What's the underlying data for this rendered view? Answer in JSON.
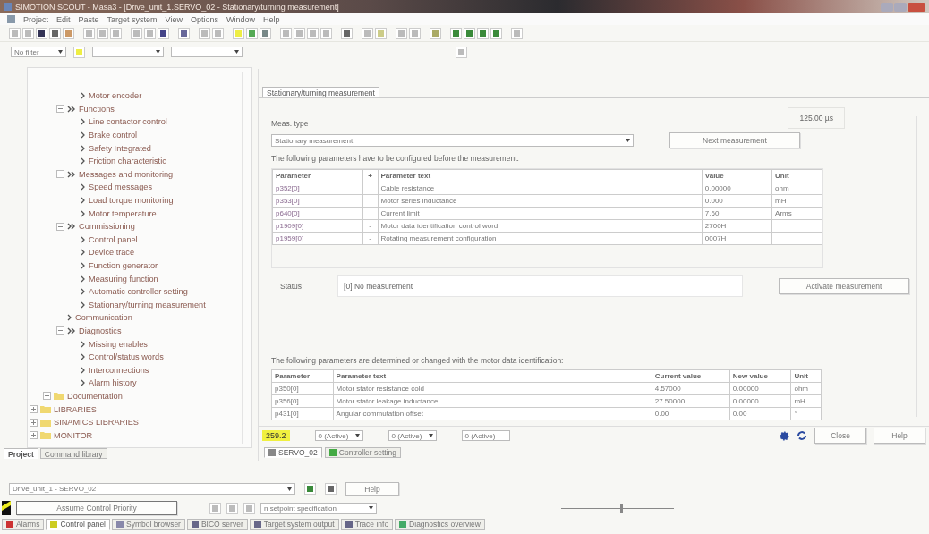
{
  "window": {
    "title": "SIMOTION SCOUT - Masa3 - [Drive_unit_1.SERVO_02 - Stationary/turning measurement]"
  },
  "menu": [
    "Project",
    "Edit",
    "Paste",
    "Target system",
    "View",
    "Options",
    "Window",
    "Help"
  ],
  "filter": {
    "value": "No filter"
  },
  "tree": [
    {
      "children": [
        {
          "children": [
            {
              "children": [
                {
                  "label": "Motor encoder",
                  "kind": "function"
                }
              ]
            },
            {
              "label": "Functions",
              "kind": "section",
              "expanded": true,
              "children": [
                {
                  "label": "Line contactor control",
                  "kind": "function"
                },
                {
                  "label": "Brake control",
                  "kind": "function"
                },
                {
                  "label": "Safety Integrated",
                  "kind": "function"
                },
                {
                  "label": "Friction characteristic",
                  "kind": "function"
                }
              ]
            },
            {
              "label": "Messages and monitoring",
              "kind": "section",
              "expanded": true,
              "children": [
                {
                  "label": "Speed messages",
                  "kind": "function"
                },
                {
                  "label": "Load torque monitoring",
                  "kind": "function"
                },
                {
                  "label": "Motor temperature",
                  "kind": "function"
                }
              ]
            },
            {
              "label": "Commissioning",
              "kind": "section",
              "expanded": true,
              "children": [
                {
                  "label": "Control panel",
                  "kind": "function"
                },
                {
                  "label": "Device trace",
                  "kind": "function"
                },
                {
                  "label": "Function generator",
                  "kind": "function"
                },
                {
                  "label": "Measuring function",
                  "kind": "function"
                },
                {
                  "label": "Automatic controller setting",
                  "kind": "function"
                },
                {
                  "label": "Stationary/turning measurement",
                  "kind": "function"
                }
              ]
            },
            {
              "label": "Communication",
              "kind": "function"
            },
            {
              "label": "Diagnostics",
              "kind": "section",
              "expanded": true,
              "children": [
                {
                  "label": "Missing enables",
                  "kind": "function"
                },
                {
                  "label": "Control/status words",
                  "kind": "function"
                },
                {
                  "label": "Interconnections",
                  "kind": "function"
                },
                {
                  "label": "Alarm history",
                  "kind": "function"
                }
              ]
            }
          ]
        },
        {
          "label": "Documentation",
          "kind": "folder",
          "expanded": false
        }
      ]
    },
    {
      "label": "LIBRARIES",
      "kind": "folder",
      "expanded": false
    },
    {
      "label": "SINAMICS LIBRARIES",
      "kind": "folder",
      "expanded": false
    },
    {
      "label": "MONITOR",
      "kind": "folder",
      "expanded": false
    }
  ],
  "left_tabs": [
    {
      "label": "Project",
      "selected": true
    },
    {
      "label": "Command library",
      "selected": false
    }
  ],
  "editor": {
    "tab": "Stationary/turning measurement",
    "meas_time": "125.00 µs",
    "meas_type_label": "Meas. type",
    "meas_type": "Stationary measurement",
    "next_button": "Next measurement",
    "params_intro": "The following parameters have to be configured before the measurement:",
    "params_table": {
      "columns": [
        "Parameter",
        "+",
        "Parameter text",
        "Value",
        "Unit"
      ],
      "rows": [
        [
          "p352[0]",
          "",
          "Cable resistance",
          "0.00000",
          "ohm"
        ],
        [
          "p353[0]",
          "",
          "Motor series inductance",
          "0.000",
          "mH"
        ],
        [
          "p640[0]",
          "",
          "Current limit",
          "7.60",
          "Arms"
        ],
        [
          "p1909[0]",
          "-",
          "Motor data identification control word",
          "2700H",
          ""
        ],
        [
          "p1959[0]",
          "-",
          "Rotating measurement configuration",
          "0007H",
          ""
        ]
      ]
    },
    "status_label": "Status",
    "status_value": "[0] No measurement",
    "activate_button": "Activate measurement",
    "results_intro": "The following parameters are determined or changed with the motor data identification:",
    "results_table": {
      "columns": [
        "Parameter",
        "Parameter text",
        "Current value",
        "New value",
        "Unit"
      ],
      "rows": [
        [
          "p350[0]",
          "Motor stator resistance cold",
          "4.57000",
          "0.00000",
          "ohm"
        ],
        [
          "p356[0]",
          "Motor stator leakage inductance",
          "27.50000",
          "0.00000",
          "mH"
        ],
        [
          "p431[0]",
          "Angular commutation offset",
          "0.00",
          "0.00",
          "°"
        ]
      ]
    }
  },
  "editor_status": {
    "value": "259.2",
    "sets": [
      "0 (Active)",
      "0 (Active)",
      "0 (Active)"
    ],
    "close_button": "Close",
    "help_button": "Help"
  },
  "editor_tabs": [
    {
      "label": "SERVO_02",
      "selected": true
    },
    {
      "label": "Controller setting",
      "selected": false
    }
  ],
  "detail": {
    "drive": "Drive_unit_1 - SERVO_02",
    "help_button": "Help",
    "priority_button": "Assume Control Priority",
    "setpoint": "n setpoint specification",
    "slider": {
      "level": 0.53
    }
  },
  "bottom_tabs": [
    {
      "label": "Alarms",
      "selected": false
    },
    {
      "label": "Control panel",
      "selected": true
    },
    {
      "label": "Symbol browser",
      "selected": false
    },
    {
      "label": "BICO server",
      "selected": false
    },
    {
      "label": "Target system output",
      "selected": false
    },
    {
      "label": "Trace info",
      "selected": false
    },
    {
      "label": "Diagnostics overview",
      "selected": false
    }
  ]
}
